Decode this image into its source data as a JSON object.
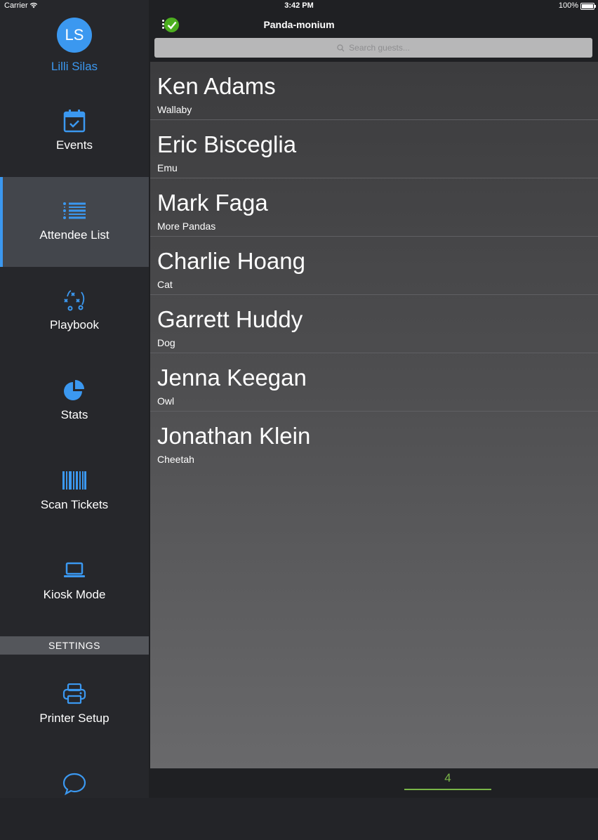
{
  "status_bar": {
    "carrier": "Carrier",
    "time": "3:42 PM",
    "battery": "100%"
  },
  "sidebar": {
    "avatar_initials": "LS",
    "user_name": "Lilli Silas",
    "items": [
      {
        "label": "Events",
        "icon": "calendar-check-icon"
      },
      {
        "label": "Attendee List",
        "icon": "list-icon"
      },
      {
        "label": "Playbook",
        "icon": "playbook-icon"
      },
      {
        "label": "Stats",
        "icon": "pie-chart-icon"
      },
      {
        "label": "Scan Tickets",
        "icon": "barcode-icon"
      },
      {
        "label": "Kiosk Mode",
        "icon": "laptop-icon"
      }
    ],
    "settings_header": "SETTINGS",
    "settings_items": [
      {
        "label": "Printer Setup",
        "icon": "printer-icon"
      },
      {
        "label": "",
        "icon": "chat-bubble-icon"
      }
    ],
    "active_item": "Attendee List"
  },
  "header": {
    "title": "Panda-monium",
    "search_placeholder": "Search guests..."
  },
  "attendees": [
    {
      "name": "Ken Adams",
      "group": "Wallaby"
    },
    {
      "name": "Eric Bisceglia",
      "group": "Emu"
    },
    {
      "name": "Mark Faga",
      "group": "More Pandas"
    },
    {
      "name": "Charlie Hoang",
      "group": "Cat"
    },
    {
      "name": "Garrett Huddy",
      "group": "Dog"
    },
    {
      "name": "Jenna Keegan",
      "group": "Owl"
    },
    {
      "name": "Jonathan Klein",
      "group": "Cheetah"
    }
  ],
  "footer": {
    "count": "4"
  },
  "colors": {
    "accent": "#3b98f0",
    "success": "#4cae1f",
    "count": "#7ab648"
  }
}
